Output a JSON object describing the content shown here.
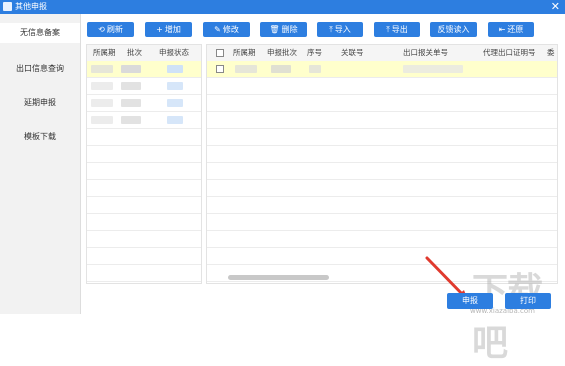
{
  "window": {
    "title": "其他申报",
    "close_glyph": "✕"
  },
  "sidebar": {
    "items": [
      {
        "label": "无信息备案",
        "active": true
      },
      {
        "label": "出口信息查询",
        "active": false
      },
      {
        "label": "延期申报",
        "active": false
      },
      {
        "label": "模板下载",
        "active": false
      }
    ]
  },
  "toolbar": {
    "refresh": {
      "icon": "⟲",
      "label": "刷新"
    },
    "add": {
      "icon": "+",
      "label": "增加"
    },
    "edit": {
      "icon": "✎",
      "label": "修改"
    },
    "delete": {
      "icon": "🗑",
      "label": "删除"
    },
    "import": {
      "icon": "⤒",
      "label": "导入"
    },
    "export": {
      "icon": "⤒",
      "label": "导出"
    },
    "feedback": {
      "label": "反馈读入"
    },
    "restore": {
      "icon": "⇤",
      "label": "还原"
    }
  },
  "left_table": {
    "headers": [
      "所属期",
      "批次",
      "申报状态"
    ]
  },
  "right_table": {
    "headers": [
      "所属期",
      "申报批次",
      "序号",
      "关联号",
      "出口报关单号",
      "代理出口证明号",
      "委"
    ]
  },
  "bottom": {
    "declare_label": "申报",
    "print_label": "打印"
  },
  "watermark": {
    "text": "下载吧",
    "sub": "www.xiazaiba.com"
  },
  "colors": {
    "primary": "#2d7ee0",
    "selected_row": "#ffffcc",
    "arrow": "#e03a2e"
  }
}
